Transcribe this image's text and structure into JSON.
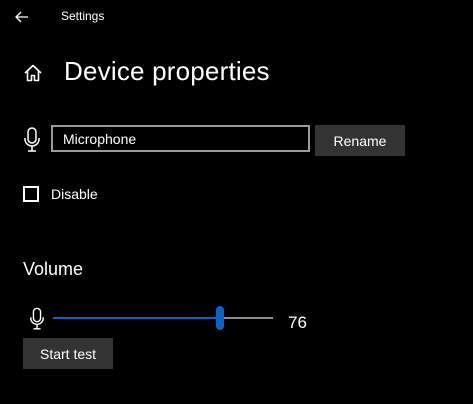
{
  "titlebar": {
    "app_title": "Settings",
    "back_icon": "arrow-left-icon"
  },
  "header": {
    "home_icon": "home-icon",
    "title": "Device properties"
  },
  "device": {
    "mic_icon": "microphone-icon",
    "name_value": "Microphone",
    "rename_label": "Rename",
    "disable_label": "Disable",
    "disable_checked": false
  },
  "volume": {
    "section_title": "Volume",
    "mic_icon": "microphone-icon",
    "level_percent": 76,
    "value_text": "76",
    "start_test_label": "Start test"
  },
  "colors": {
    "background": "#000000",
    "accent": "#0a64c8",
    "button_bg": "#333333",
    "input_border": "#9a9a9a",
    "text": "#ffffff"
  }
}
